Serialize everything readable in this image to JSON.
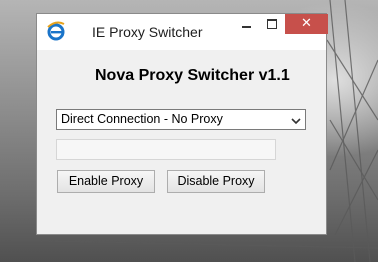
{
  "window": {
    "title": "IE Proxy Switcher",
    "close_symbol": "✕"
  },
  "main": {
    "heading": "Nova Proxy Switcher v1.1",
    "proxy_select": {
      "selected": "Direct Connection - No Proxy"
    },
    "status_value": "",
    "enable_button_label": "Enable Proxy",
    "disable_button_label": "Disable Proxy"
  },
  "icons": {
    "app_icon": "ie-logo-icon",
    "minimize": "minimize-icon",
    "maximize": "maximize-icon",
    "close": "close-icon",
    "dropdown": "chevron-down-icon"
  },
  "colors": {
    "close_button_bg": "#c7504b",
    "window_bg": "#f0f0f0",
    "ie_logo_blue": "#1a74c9"
  }
}
